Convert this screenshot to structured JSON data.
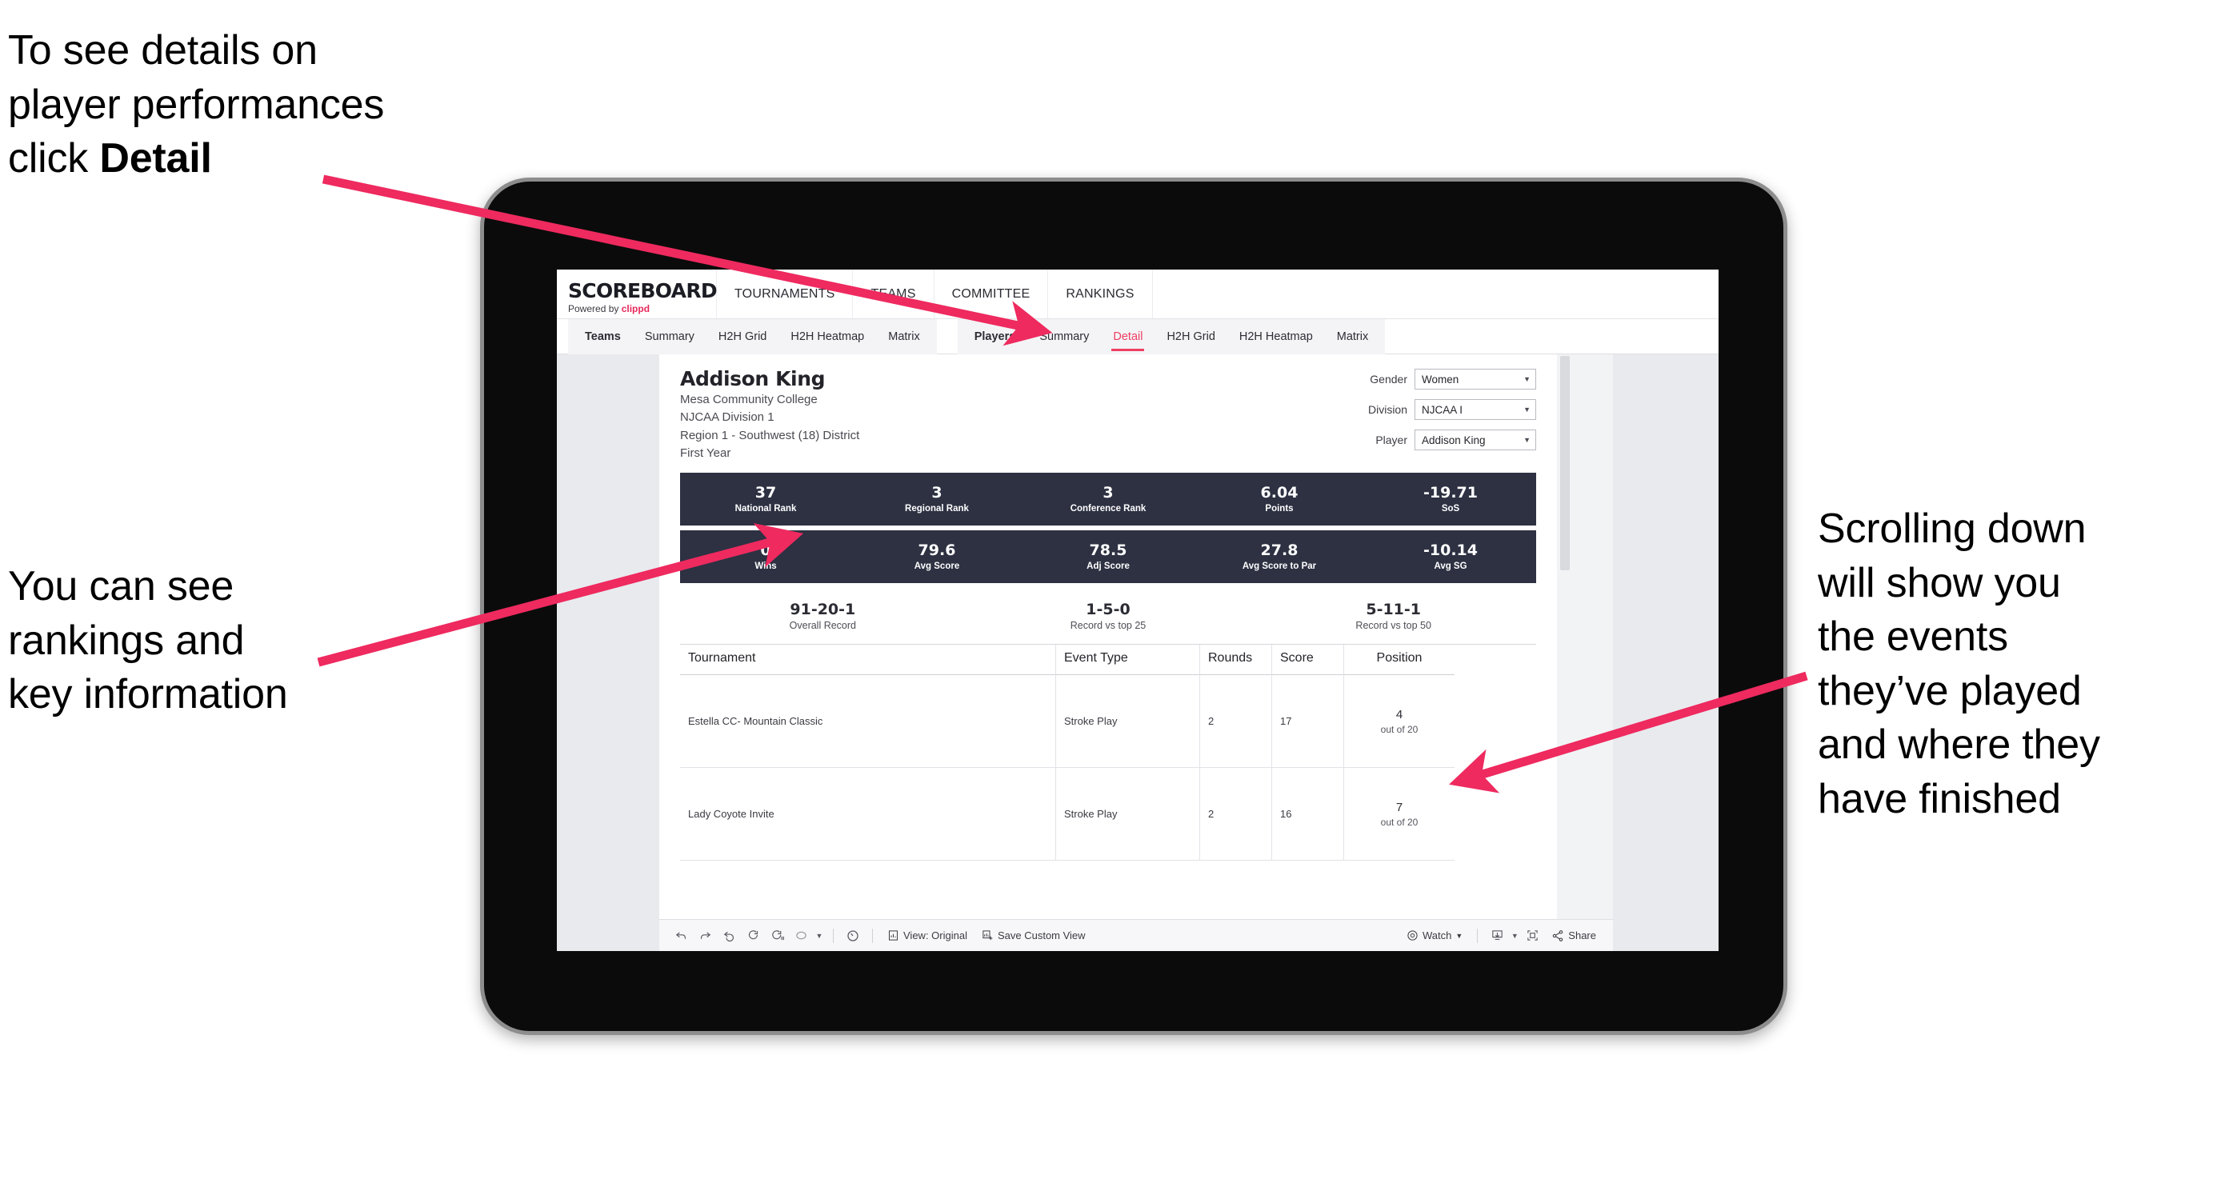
{
  "annotations": {
    "top_left_line1": "To see details on",
    "top_left_line2": "player performances",
    "top_left_line3_prefix": "click ",
    "top_left_line3_bold": "Detail",
    "mid_left_line1": "You can see",
    "mid_left_line2": "rankings and",
    "mid_left_line3": "key information",
    "right_line1": "Scrolling down",
    "right_line2": "will show you",
    "right_line3": "the events",
    "right_line4": "they’ve played",
    "right_line5": "and where they",
    "right_line6": "have finished",
    "arrow_color": "#ee2a5f"
  },
  "app": {
    "brand": {
      "title": "SCOREBOARD",
      "powered_prefix": "Powered by ",
      "powered_name": "clippd"
    },
    "topnav": [
      "TOURNAMENTS",
      "TEAMS",
      "COMMITTEE",
      "RANKINGS"
    ],
    "tabs_teams": [
      "Teams",
      "Summary",
      "H2H Grid",
      "H2H Heatmap",
      "Matrix"
    ],
    "tabs_players": [
      "Players",
      "Summary",
      "Detail",
      "H2H Grid",
      "H2H Heatmap",
      "Matrix"
    ],
    "active_tab": "Detail",
    "accent_color": "#ef3e63",
    "band_color": "#2d3142"
  },
  "player": {
    "name": "Addison King",
    "school": "Mesa Community College",
    "division": "NJCAA Division 1",
    "region": "Region 1 - Southwest (18) District",
    "year": "First Year"
  },
  "filters": [
    {
      "label": "Gender",
      "value": "Women"
    },
    {
      "label": "Division",
      "value": "NJCAA I"
    },
    {
      "label": "Player",
      "value": "Addison King"
    }
  ],
  "stats_row1": [
    {
      "value": "37",
      "label": "National Rank"
    },
    {
      "value": "3",
      "label": "Regional Rank"
    },
    {
      "value": "3",
      "label": "Conference Rank"
    },
    {
      "value": "6.04",
      "label": "Points"
    },
    {
      "value": "-19.71",
      "label": "SoS"
    }
  ],
  "stats_row2": [
    {
      "value": "0",
      "label": "Wins"
    },
    {
      "value": "79.6",
      "label": "Avg Score"
    },
    {
      "value": "78.5",
      "label": "Adj Score"
    },
    {
      "value": "27.8",
      "label": "Avg Score to Par"
    },
    {
      "value": "-10.14",
      "label": "Avg SG"
    }
  ],
  "records": [
    {
      "value": "91-20-1",
      "label": "Overall Record"
    },
    {
      "value": "1-5-0",
      "label": "Record vs top 25"
    },
    {
      "value": "5-11-1",
      "label": "Record vs top 50"
    }
  ],
  "table": {
    "headers": [
      "Tournament",
      "Event Type",
      "Rounds",
      "Score",
      "Position"
    ],
    "rows": [
      {
        "tournament": "Estella CC- Mountain Classic",
        "event_type": "Stroke Play",
        "rounds": "2",
        "score": "17",
        "position": "4",
        "position_sub": "out of 20"
      },
      {
        "tournament": "Lady Coyote Invite",
        "event_type": "Stroke Play",
        "rounds": "2",
        "score": "16",
        "position": "7",
        "position_sub": "out of 20"
      }
    ]
  },
  "toolbar": {
    "view_label": "View: Original",
    "save_label": "Save Custom View",
    "watch_label": "Watch",
    "share_label": "Share"
  }
}
